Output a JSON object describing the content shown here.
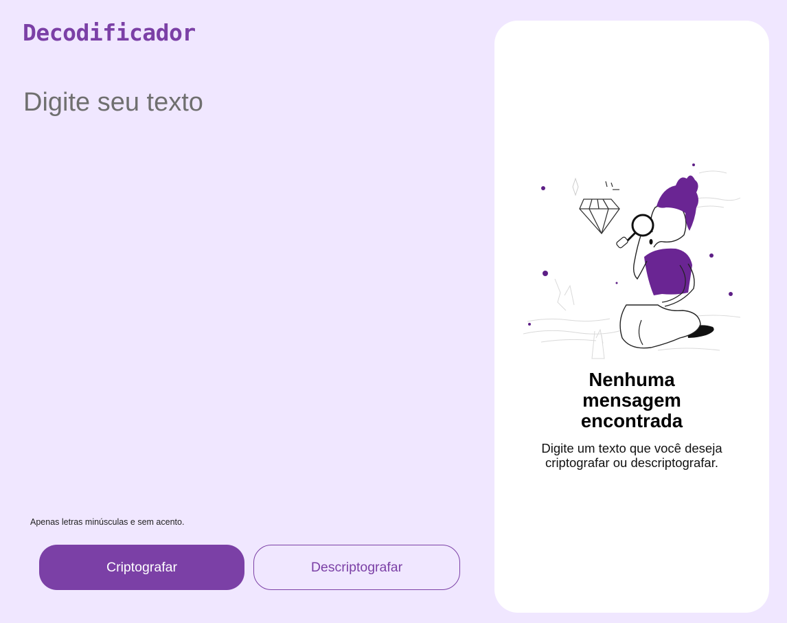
{
  "header": {
    "logo_text": "Decodificador"
  },
  "input": {
    "placeholder": "Digite seu texto",
    "value": ""
  },
  "hint": {
    "icon": "info-icon",
    "text": "Apenas letras minúsculas e sem acento."
  },
  "actions": {
    "encrypt_label": "Criptografar",
    "decrypt_label": "Descriptografar"
  },
  "output": {
    "illustration": "person-with-magnifying-glass-and-diamond",
    "title_lines": [
      "Nenhuma",
      "mensagem",
      "encontrada"
    ],
    "subtitle_lines": [
      "Digite um texto que você deseja",
      "criptografar ou descriptografar."
    ]
  },
  "colors": {
    "background": "#f0e7ff",
    "accent": "#7b40a6",
    "card": "#ffffff"
  }
}
